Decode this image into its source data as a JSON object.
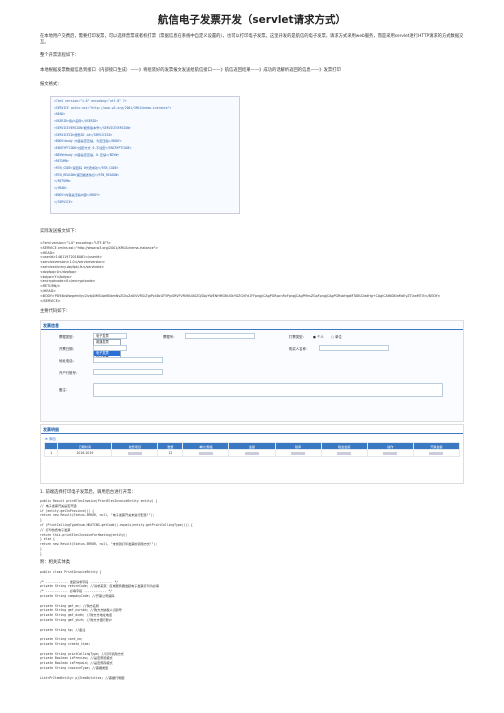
{
  "title": "航信电子发票开发（servlet请求方式）",
  "intro": "在本地用户交费后，需要打印发票，可以选择普票或者机打票（票据信息在系统中自定义设置的），也可以打印电子发票。这里开发的是航信的电子发票，请求方式采用web服务，而是采用servlet进行HTTP请求的方式数据交互。",
  "flow_heading": "整个开票流程如下：",
  "flow": "本地根据发票数据信息到接口（内部接口生成）——》将组装好的发票报文发送给航信接口——》航信返回结果——》成功的话解析返回的信息——》发票打印",
  "request_heading": "报文格式：",
  "xml_template": [
    "<?xml version=\"1.0\" encoding=\"utf-8\" ?>",
    "<SERVICE xmlns:xsi=\"http://www.w3.org/2001/XMLSchema-instance\">",
    "  <HEAD>",
    "    <USERID>用户名称</USERID>",
    "    <SERVICEVERSION>服务版本号</SERVICEVERSION>",
    "    <SERVICEID>服务ID id</SERVICEID>",
    "    <BODY>body 内容是否压缩，为否压缩</BODY>",
    "      <ENCRYPTCODE>加密方式 0-不加密</ENCRYPTCODE>",
    "    <BDYW>body 内容是否压缩，0-压缩</BDYW>",
    "    <RETURN>",
    "      <RTN_CODE>返回码 0代表成功</RTN_CODE>",
    "      <RTN_REASON>返回描述信息</RTN_REASON>",
    "    </RETURN>",
    "  </HEAD>",
    "  <BODY>内容是压缩内容</BODY>",
    "</SERVICE>"
  ],
  "actual_heading": "实际发送报文如下：",
  "actual_xml": [
    "<?xml version=\"1.0\" encoding=\"UTF-8\"?>",
    "<SERVICE xmlns:xsi=\"http://www.w3.org/2001/XMLSchema-instance\">",
    "  <HEAD>",
    "    <userId>14611972018061</userId>",
    "    <serviceversion>1.0</serviceversion>",
    "    <serviceid>ecy.dzpfpkj.fs</serviceid>",
    "    <dzpfpq>0</dzpfpq>",
    "    <bdyw>Y</bdyw>",
    "    <encryptcode>0</encryptcode>",
    "    <RETURN/>",
    "  </HEAD>",
    "  <BODY>PD94bWwgdmVyc2lvbj0iMS4wIiBlbmNvZGluZz0iVVRGLTgiPz48cGF5PjxSRVFVRVNUX0ZQS0pYWENHMGNUSkY0ZGVFd1FFpngjiCAgPGRpcnRvFpngjCAgPHhsZGpFpngjCAgPGRsbHgzMTABU2ddHg+CAgICAtNDEwMzEyZTUwMTI5</BODY>",
    "</SERVICE>"
  ],
  "ui_heading": "主要代码如下：",
  "ui": {
    "section1": "发票信息",
    "fields": {
      "invoice_type_label": "票据类型：",
      "invoice_type_value": "电子发票",
      "invoice_no_label": "票据号：",
      "print_type_label": "打票类型：",
      "print_type_a": "个人",
      "print_type_b": "单位",
      "open_date_label": "开票日期：",
      "buyer_label": "购买人名称：",
      "address_label": "地址电话：",
      "bank_label": "开户行账号：",
      "remark_label": "备注："
    },
    "dropdown_options": [
      "普通发票",
      "增值发票",
      "电子发票",
      "其他发票"
    ],
    "dropdown_selected_index": 2,
    "section2": "发票明细",
    "add_button": "添加",
    "columns": [
      "",
      "日期时间",
      "收费项目",
      "数量",
      "单价/规格",
      "金额",
      "税率",
      "税金金额",
      "操作",
      "开票金额"
    ],
    "row": [
      "1",
      "2016-2019",
      "",
      "12",
      "",
      "",
      "",
      "",
      "",
      ""
    ]
  },
  "step1": "1. 前端选择打印电子发票后，调用后台进行开票：",
  "code1": [
    "public Result printElecInvoice(PrintElecInvoiceEntity entity) {",
    "    // 电子发票开关是否开通",
    "    if (entity.getIsProvince()) {",
    "        return new Result(Status.ERROR, null, \"电子发票开关未进行配置!\");",
    "    }",
    "    if (PrintCallingTypeEnum.HEATING.getCode().equals(entity.getPrintCallingType())) {",
    "        // 打印热费电子发票",
    "        return this.printElecInvoiceForHeating(entity);",
    "    } else {",
    "        return new Result(Status.ERROR, null, \"未找到打印发票的调用方式!\");",
    "    }",
    "}"
  ],
  "step2": "附：相关实体类",
  "code2": [
    "public class PrintInvoiceEntity {",
    "",
    "    /* ------------ 发起请求字段 ------------ */",
    "    private String returnCode; //请求来源：区域服务器发起电子发票打印为必填",
    "    /* ------------ 必填字段 ------------ */",
    "    private String companyCode; //开票公司编码",
    "",
    "    private String gmf_mc; //购方名称",
    "    private String gmf_nsrsbh; //购方方纳税人识别号",
    "    private String gmf_dzdh; //购方方地址电话",
    "    private String gmf_yhzh; //购方方银行账户",
    "",
    "    private String kp; //备注",
    "",
    "    private String card_no;",
    "    private String create_time;",
    "",
    "    private String printCallingType; //打印调用方式",
    "    private Boolean isPreview; //是否预览模式",
    "    private Boolean isPrepaid; //是否预存模式",
    "    private String invoiceType; //票据类型",
    "",
    "    List<PrItemEntity> pjItemEntities; //票据行明细"
  ]
}
